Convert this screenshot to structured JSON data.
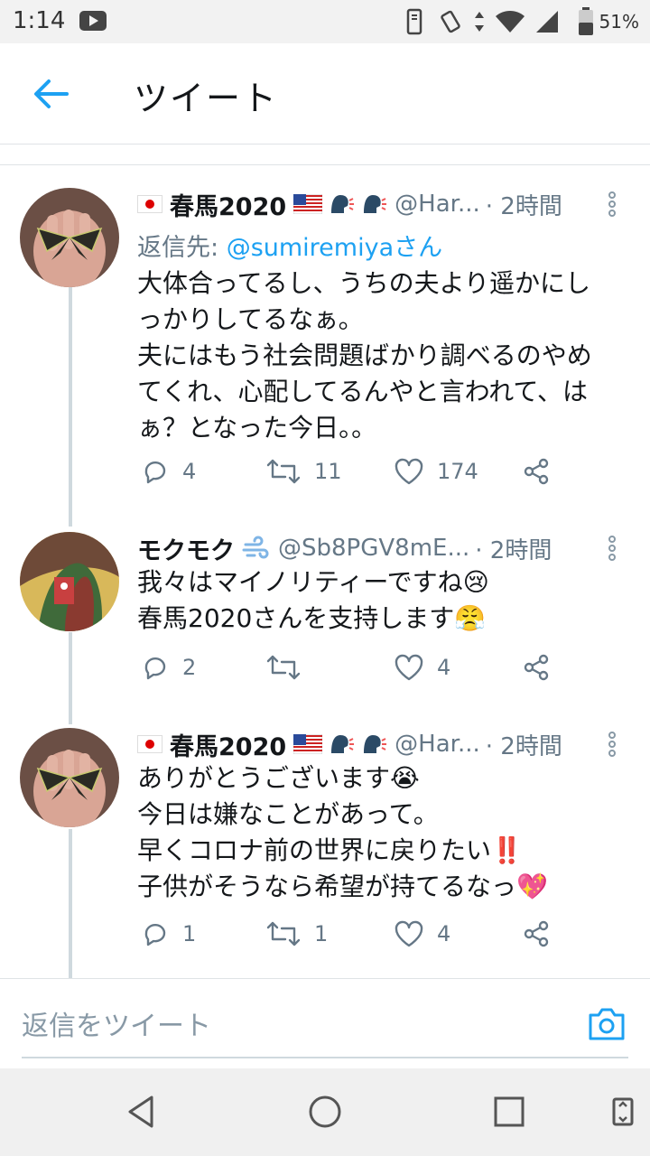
{
  "status_bar": {
    "time": "1:14",
    "battery": "51%"
  },
  "header": {
    "title": "ツイート"
  },
  "tweets": [
    {
      "name": "春馬2020",
      "handle": "@Har...",
      "time": "· 2時間",
      "reply_prefix": "返信先: ",
      "reply_to": "@sumiremiyaさん",
      "text": "大体合ってるし、うちの夫より遥かにし\nっかりしてるなぁ。\n夫にはもう社会問題ばかり調べるのやめ\nてくれ、心配してるんやと言われて、は\nぁ？となった今日。。",
      "replies": "4",
      "retweets": "11",
      "likes": "174"
    },
    {
      "name": "モクモク",
      "handle": "@Sb8PGV8mE...",
      "time": "· 2時間",
      "text": "我々はマイノリティーですね😢\n春馬2020さんを支持します😤",
      "replies": "2",
      "retweets": "",
      "likes": "4"
    },
    {
      "name": "春馬2020",
      "handle": "@Har...",
      "time": "· 2時間",
      "text": "ありがとうございます😭\n今日は嫌なことがあって。\n早くコロナ前の世界に戻りたい‼️\n子供がそうなら希望が持てるなっ💖",
      "replies": "1",
      "retweets": "1",
      "likes": "4"
    }
  ],
  "reply_bar": {
    "placeholder": "返信をツイート"
  },
  "colors": {
    "accent": "#1da1f2",
    "secondary_text": "#657786",
    "divider": "#dfe3e6"
  },
  "icons": [
    "back-arrow-icon",
    "more-vertical-icon",
    "reply-icon",
    "retweet-icon",
    "like-icon",
    "share-icon",
    "camera-icon",
    "nav-back-icon",
    "nav-home-icon",
    "nav-recents-icon",
    "nav-rotate-icon"
  ]
}
